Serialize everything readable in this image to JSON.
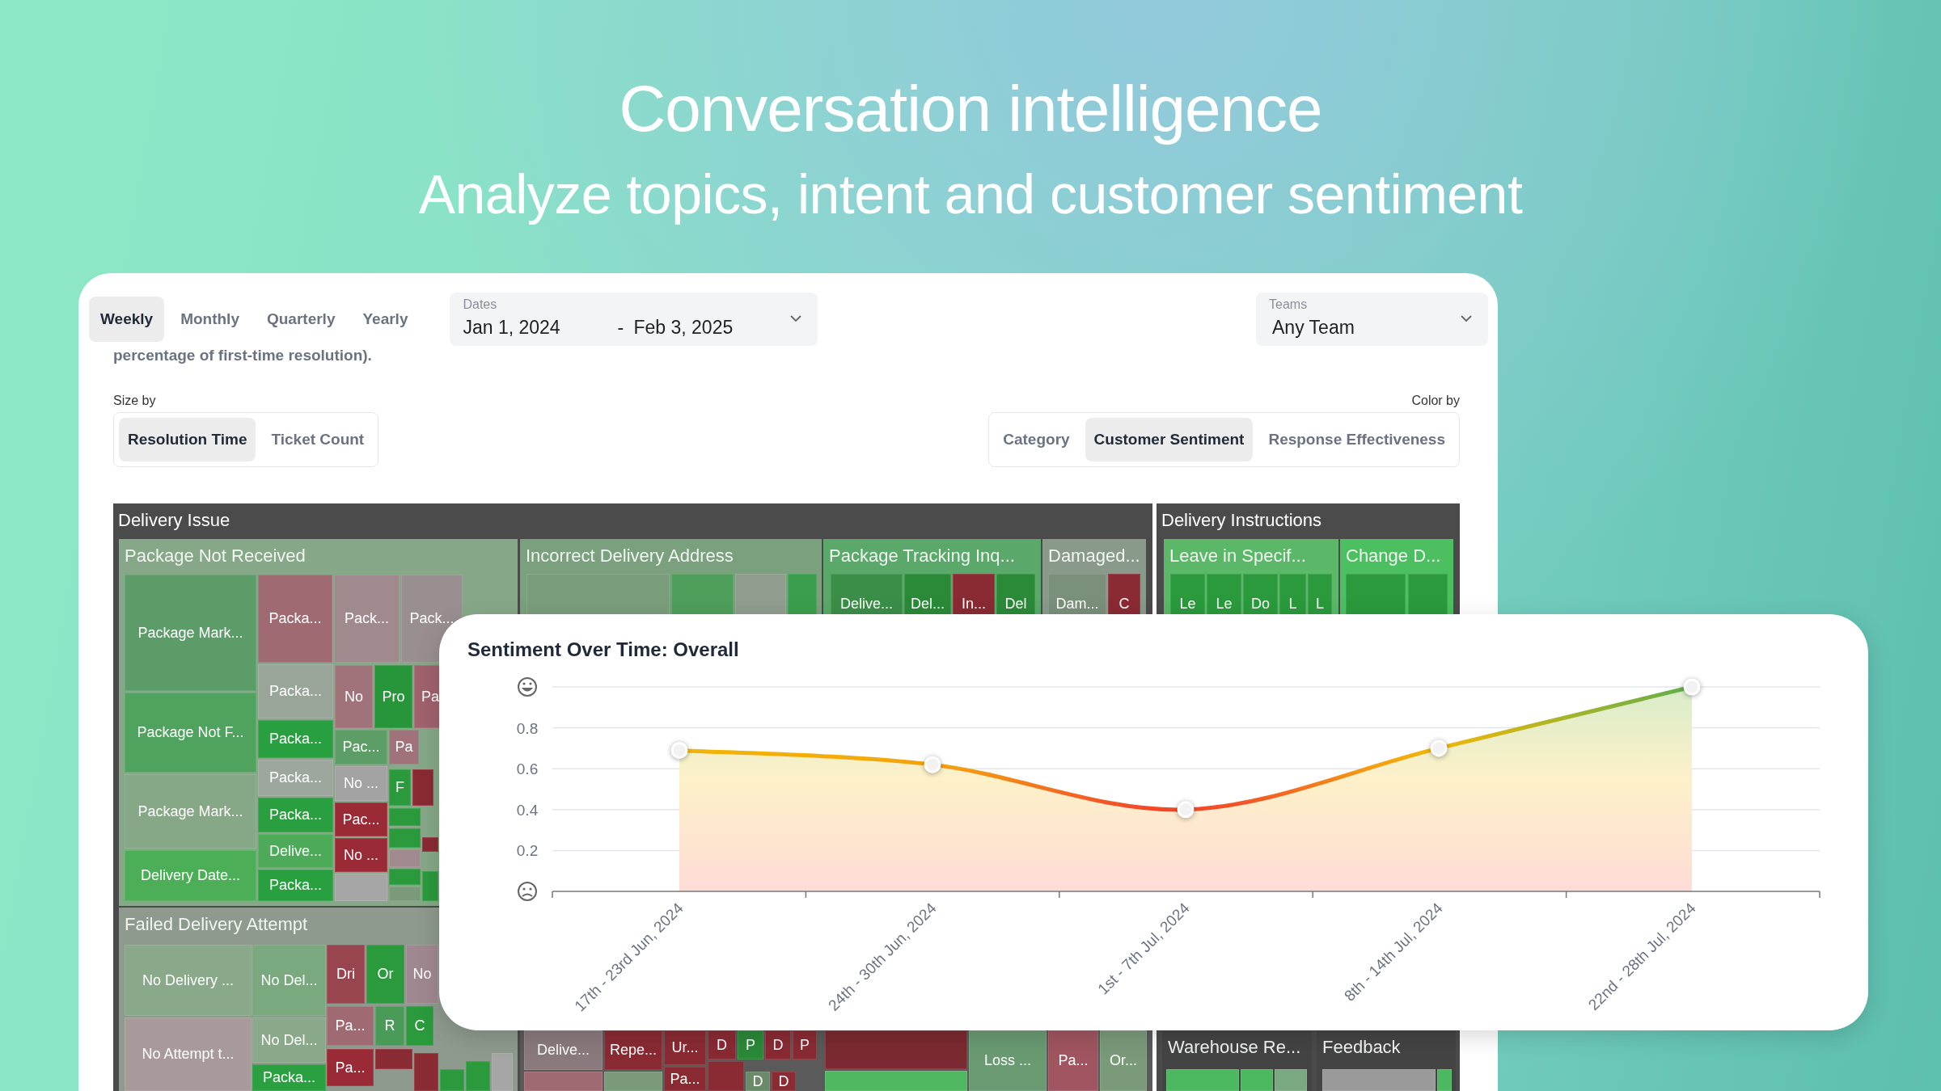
{
  "hero": {
    "title": "Conversation intelligence",
    "subtitle": "Analyze topics, intent and customer sentiment"
  },
  "period_tabs": [
    {
      "label": "Weekly",
      "selected": true
    },
    {
      "label": "Monthly",
      "selected": false
    },
    {
      "label": "Quarterly",
      "selected": false
    },
    {
      "label": "Yearly",
      "selected": false
    }
  ],
  "dates": {
    "label": "Dates",
    "start": "Jan 1, 2024",
    "separator": "-",
    "end": "Feb 3, 2025"
  },
  "teams": {
    "label": "Teams",
    "value": "Any Team"
  },
  "description": "percentage of first-time resolution).",
  "size_by": {
    "label": "Size by",
    "options": [
      {
        "label": "Resolution Time",
        "selected": true
      },
      {
        "label": "Ticket Count",
        "selected": false
      }
    ]
  },
  "color_by": {
    "label": "Color by",
    "options": [
      {
        "label": "Category",
        "selected": false
      },
      {
        "label": "Customer Sentiment",
        "selected": true
      },
      {
        "label": "Response Effectiveness",
        "selected": false
      }
    ]
  },
  "treemap": {
    "groups": [
      {
        "title": "Delivery Issue",
        "subgroups": [
          {
            "title": "Package Not Received",
            "color": "#86a888",
            "tiles": [
              {
                "label": "Package Mark...",
                "color": "#5c9c68"
              },
              {
                "label": "Package Not F...",
                "color": "#4fa35f"
              },
              {
                "label": "Package Mark...",
                "color": "#86a886"
              },
              {
                "label": "Delivery Date...",
                "color": "#4caf58"
              },
              {
                "label": "Packa...",
                "color": "#a06a72"
              },
              {
                "label": "Pack...",
                "color": "#a08a8e"
              },
              {
                "label": "Pack...",
                "color": "#998f90"
              },
              {
                "label": "Packa...",
                "color": "#9aa59a"
              },
              {
                "label": "Packa...",
                "color": "#28a040"
              },
              {
                "label": "Packa...",
                "color": "#9ea79e"
              },
              {
                "label": "Packa...",
                "color": "#2a9f40"
              },
              {
                "label": "Delive...",
                "color": "#4caa58"
              },
              {
                "label": "Packa...",
                "color": "#28a040"
              },
              {
                "label": "No",
                "color": "#a0727a"
              },
              {
                "label": "Pro",
                "color": "#27963a"
              },
              {
                "label": "Pa",
                "color": "#a0626c"
              },
              {
                "label": "Pac...",
                "color": "#5c9e66"
              },
              {
                "label": "Pa",
                "color": "#a0727a"
              },
              {
                "label": "No ...",
                "color": "#a3a3a3"
              },
              {
                "label": "F",
                "color": "#2a9a3c"
              },
              {
                "color": "#8a2a33"
              },
              {
                "label": "Pac...",
                "color": "#9a2a35"
              },
              {
                "label": "No ...",
                "color": "#9a2a35"
              },
              {
                "color": "#a6a6a6"
              },
              {
                "color": "#2a9a3c"
              },
              {
                "color": "#2a9a3c"
              },
              {
                "color": "#a08a8e"
              },
              {
                "color": "#2a9a3c"
              },
              {
                "color": "#7a9a7a"
              },
              {
                "color": "#8a2a33"
              },
              {
                "color": "#2a9a3c"
              }
            ]
          },
          {
            "title": "Incorrect Delivery Address",
            "color": "#7aa07e",
            "tiles": [
              {
                "color": "#7a9e7c"
              },
              {
                "color": "#4f9e5c"
              },
              {
                "color": "#8f9e8f"
              },
              {
                "color": "#3a9e4c"
              }
            ]
          },
          {
            "title": "Package Tracking Inq...",
            "color": "#5aa86a",
            "tiles": [
              {
                "label": "Delive...",
                "color": "#3a8e48"
              },
              {
                "label": "Del...",
                "color": "#2a8a38"
              },
              {
                "label": "In...",
                "color": "#8a2a33"
              },
              {
                "label": "Del",
                "color": "#2a8a38"
              }
            ]
          },
          {
            "title": "Damaged...",
            "color": "#8a9a8a",
            "tiles": [
              {
                "label": "Dam...",
                "color": "#7a907a"
              },
              {
                "label": "C",
                "color": "#8a2a33"
              }
            ]
          },
          {
            "title": "Failed Delivery Attempt",
            "color": "#8e9a8e",
            "tiles": [
              {
                "label": "No Delivery ...",
                "color": "#8aa88a"
              },
              {
                "label": "No Attempt t...",
                "color": "#a89a9a"
              },
              {
                "label": "No Del...",
                "color": "#7aa87f"
              },
              {
                "label": "No Del...",
                "color": "#8aa88a"
              },
              {
                "label": "Packa...",
                "color": "#2aa040"
              },
              {
                "label": "Dri",
                "color": "#994550"
              },
              {
                "label": "Or",
                "color": "#2a9a3c"
              },
              {
                "label": "No",
                "color": "#a08890"
              },
              {
                "label": "Pa...",
                "color": "#a06a72"
              },
              {
                "label": "R",
                "color": "#4a9a58"
              },
              {
                "label": "C",
                "color": "#2a9a3c"
              },
              {
                "label": "Pa...",
                "color": "#9a2a35"
              },
              {
                "color": "#8a2a33"
              },
              {
                "color": "#2a9a3c"
              },
              {
                "color": "#2a9a3c"
              },
              {
                "color": "#a6a6a6"
              },
              {
                "color": "#8a2a33"
              }
            ]
          },
          {
            "color": "#5a5a5a",
            "tiles": [
              {
                "label": "Delive...",
                "color": "#8a7a7e"
              },
              {
                "label": "Repe...",
                "color": "#8a2a33"
              },
              {
                "color": "#a06a72"
              },
              {
                "color": "#7a9a7a"
              },
              {
                "label": "Ur...",
                "color": "#8a2a33"
              },
              {
                "label": "Pa...",
                "color": "#8a2a33"
              },
              {
                "label": "D",
                "color": "#8a2a33"
              },
              {
                "label": "P",
                "color": "#2a8a38"
              },
              {
                "label": "D",
                "color": "#8a2a33"
              },
              {
                "label": "P",
                "color": "#8a2a33"
              },
              {
                "color": "#8a2a33"
              },
              {
                "label": "D",
                "color": "#6a8a6a"
              },
              {
                "label": "D",
                "color": "#8a2a33"
              },
              {
                "color": "#7a2a30"
              },
              {
                "color": "#4fb860"
              },
              {
                "label": "Loss ...",
                "color": "#6a9a72"
              },
              {
                "label": "Pa...",
                "color": "#a05560"
              },
              {
                "label": "Or...",
                "color": "#7a9a7a"
              }
            ]
          }
        ]
      },
      {
        "title": "Delivery Instructions",
        "subgroups": [
          {
            "title": "Leave in Specif...",
            "color": "#5ab868",
            "tiles": [
              {
                "label": "Le",
                "color": "#2a9a3c"
              },
              {
                "label": "Le",
                "color": "#2a9a3c"
              },
              {
                "label": "Do",
                "color": "#2a9a3c"
              },
              {
                "label": "L",
                "color": "#2a9a3c"
              },
              {
                "label": "L",
                "color": "#2a9a3c"
              }
            ]
          },
          {
            "title": "Change D...",
            "color": "#4cc060",
            "tiles": [
              {
                "color": "#2a9a3c"
              },
              {
                "color": "#2a9a3c"
              }
            ]
          }
        ]
      },
      {
        "subgroups": [
          {
            "title": "Warehouse Re...",
            "color": "#444444",
            "tiles": [
              {
                "color": "#4cb860"
              },
              {
                "color": "#4cb860"
              },
              {
                "color": "#7aa880"
              }
            ]
          },
          {
            "title": "Feedback",
            "color": "#444444",
            "tiles": [
              {
                "color": "#9a9a9a"
              },
              {
                "color": "#4cb860"
              }
            ]
          }
        ]
      }
    ]
  },
  "chart_card": {
    "title": "Sentiment Over Time: Overall",
    "chart_data": {
      "type": "area",
      "grid": true,
      "marker": true,
      "categories": [
        "17th - 23rd Jun, 2024",
        "24th - 30th Jun, 2024",
        "1st - 7th Jul, 2024",
        "8th - 14th Jul, 2024",
        "22nd - 28th Jul, 2024"
      ],
      "values": [
        0.69,
        0.62,
        0.4,
        0.7,
        1.0
      ],
      "ylim": [
        0,
        1
      ],
      "yticks": [
        0.2,
        0.4,
        0.6,
        0.8
      ]
    }
  }
}
